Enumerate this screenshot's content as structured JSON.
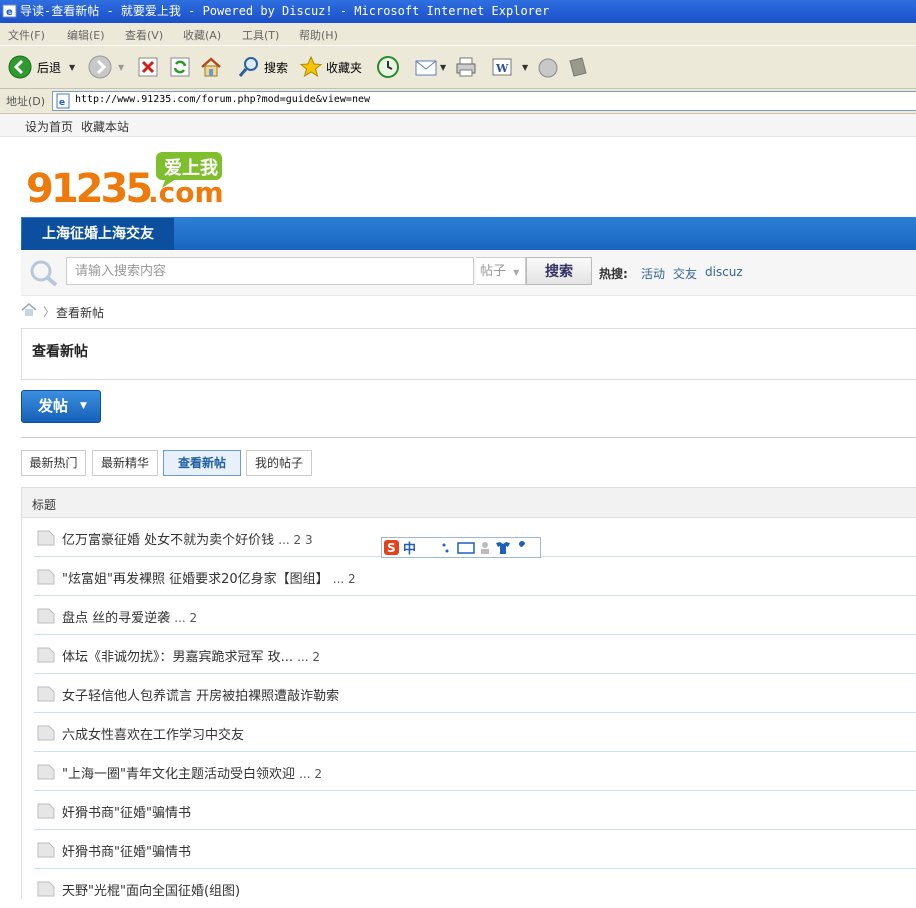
{
  "window": {
    "title": "导读-查看新帖 - 就要爱上我 - Powered by Discuz! - Microsoft Internet Explorer"
  },
  "menu": [
    "文件(F)",
    "编辑(E)",
    "查看(V)",
    "收藏(A)",
    "工具(T)",
    "帮助(H)"
  ],
  "toolbar": {
    "back_label": "后退",
    "search_label": "搜索",
    "favorites_label": "收藏夹"
  },
  "address": {
    "label": "地址(D)",
    "url": "http://www.91235.com/forum.php?mod=guide&view=new"
  },
  "topstrip": {
    "set_home": "设为首页",
    "bookmark": "收藏本站"
  },
  "logo": {
    "number": "91235",
    "badge": "爱上我",
    "domain": ".com"
  },
  "nav": {
    "active_item": "上海征婚上海交友"
  },
  "search": {
    "placeholder": "请输入搜索内容",
    "type": "帖子",
    "button": "搜索",
    "hot_label": "热搜:",
    "hot_links": [
      "活动",
      "交友",
      "discuz"
    ]
  },
  "breadcrumb": {
    "current": "查看新帖"
  },
  "page_title": "查看新帖",
  "post_button": "发帖",
  "tabs": [
    {
      "label": "最新热门",
      "active": false
    },
    {
      "label": "最新精华",
      "active": false
    },
    {
      "label": "查看新帖",
      "active": true
    },
    {
      "label": "我的帖子",
      "active": false
    }
  ],
  "thread_header": "标题",
  "threads": [
    {
      "title": "亿万富豪征婚 处女不就为卖个好价钱",
      "pages": "... 2  3"
    },
    {
      "title": "\"炫富姐\"再发裸照 征婚要求20亿身家【图组】",
      "pages": "... 2"
    },
    {
      "title": "盘点 丝的寻爱逆袭",
      "pages": "... 2"
    },
    {
      "title": "体坛《非诚勿扰》：男嘉宾跪求冠军 玫...",
      "pages": "... 2"
    },
    {
      "title": "女子轻信他人包养谎言 开房被拍裸照遭敲诈勒索",
      "pages": ""
    },
    {
      "title": "六成女性喜欢在工作学习中交友",
      "pages": ""
    },
    {
      "title": "\"上海一圈\"青年文化主题活动受白领欢迎",
      "pages": "... 2"
    },
    {
      "title": "奸猾书商\"征婚\"骗情书",
      "pages": ""
    },
    {
      "title": "奸猾书商\"征婚\"骗情书",
      "pages": ""
    },
    {
      "title": "天野\"光棍\"面向全国征婚(组图)",
      "pages": ""
    }
  ],
  "ime": {
    "label": "中"
  }
}
